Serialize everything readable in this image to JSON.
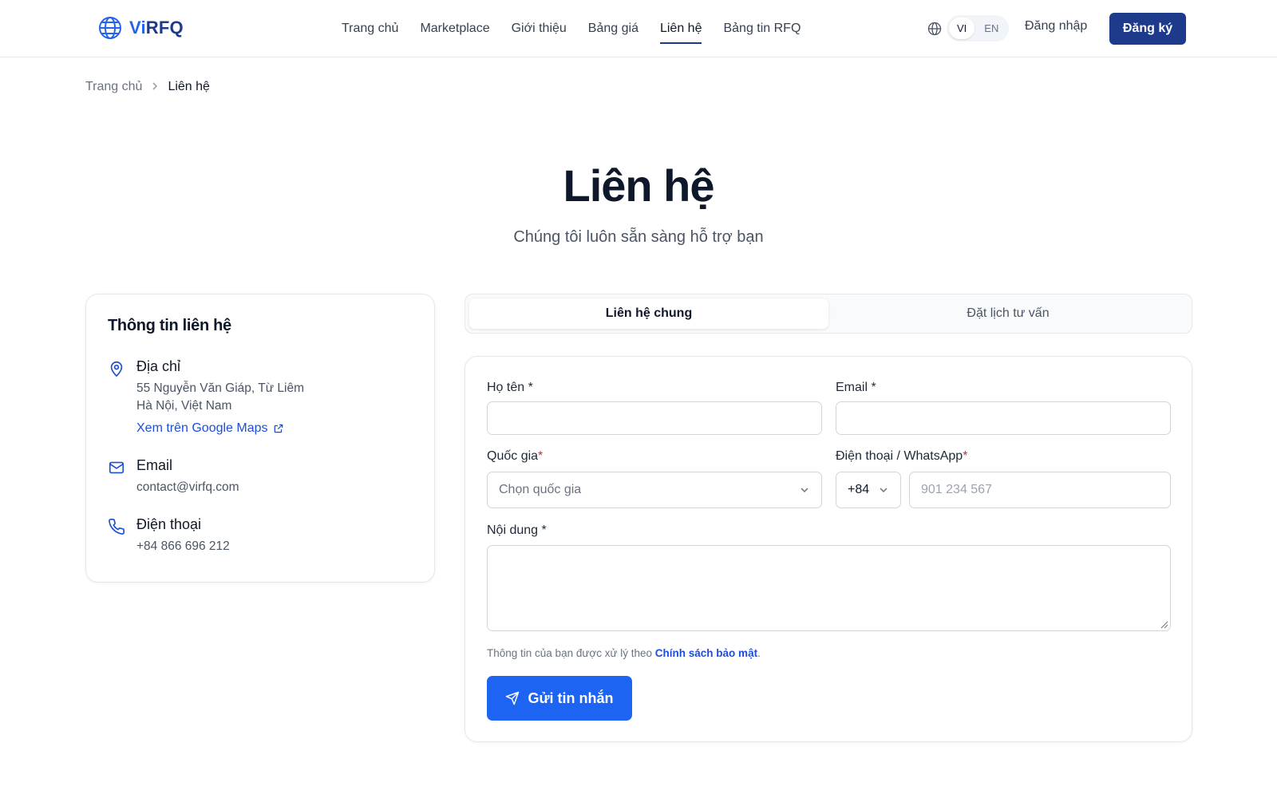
{
  "header": {
    "logo_text_prefix": "Vi",
    "logo_text_suffix": "RFQ",
    "nav": [
      {
        "label": "Trang chủ"
      },
      {
        "label": "Marketplace"
      },
      {
        "label": "Giới thiệu"
      },
      {
        "label": "Bảng giá"
      },
      {
        "label": "Liên hệ",
        "active": true
      },
      {
        "label": "Bảng tin RFQ"
      }
    ],
    "lang_vi": "VI",
    "lang_en": "EN",
    "login_label": "Đăng nhập",
    "signup_label": "Đăng ký",
    "accent_color": "#1e3a8a"
  },
  "breadcrumb": {
    "home": "Trang chủ",
    "current": "Liên hệ"
  },
  "hero": {
    "title": "Liên hệ",
    "subtitle": "Chúng tôi luôn sẵn sàng hỗ trợ bạn"
  },
  "contact_info": {
    "title": "Thông tin liên hệ",
    "address": {
      "icon": "map-pin-icon",
      "label": "Địa chỉ",
      "line1": "55 Nguyễn Văn Giáp, Từ Liêm",
      "line2": "Hà Nội, Việt Nam",
      "maps_link": "Xem trên Google Maps"
    },
    "email": {
      "icon": "mail-icon",
      "label": "Email",
      "value": "contact@virfq.com"
    },
    "phone": {
      "icon": "phone-icon",
      "label": "Điện thoại",
      "value": "+84 866 696 212"
    }
  },
  "tabs": {
    "general": "Liên hệ chung",
    "schedule": "Đặt lịch tư vấn",
    "active": "general"
  },
  "form": {
    "name_label": "Họ tên *",
    "email_label": "Email *",
    "name_value": "",
    "email_value": "",
    "country_label": "Quốc gia",
    "country_placeholder": "Chọn quốc gia",
    "phone_label": "Điện thoại / WhatsApp",
    "phone_code": "+84",
    "phone_placeholder": "901 234 567",
    "message_label": "Nội dung *",
    "message_value": "",
    "privacy_prefix": "Thông tin của bạn được xử lý theo ",
    "privacy_link": "Chính sách bảo mật",
    "privacy_suffix": ".",
    "submit_label": "Gửi tin nhắn",
    "required_mark": "*",
    "button_color": "#1d64f2"
  }
}
